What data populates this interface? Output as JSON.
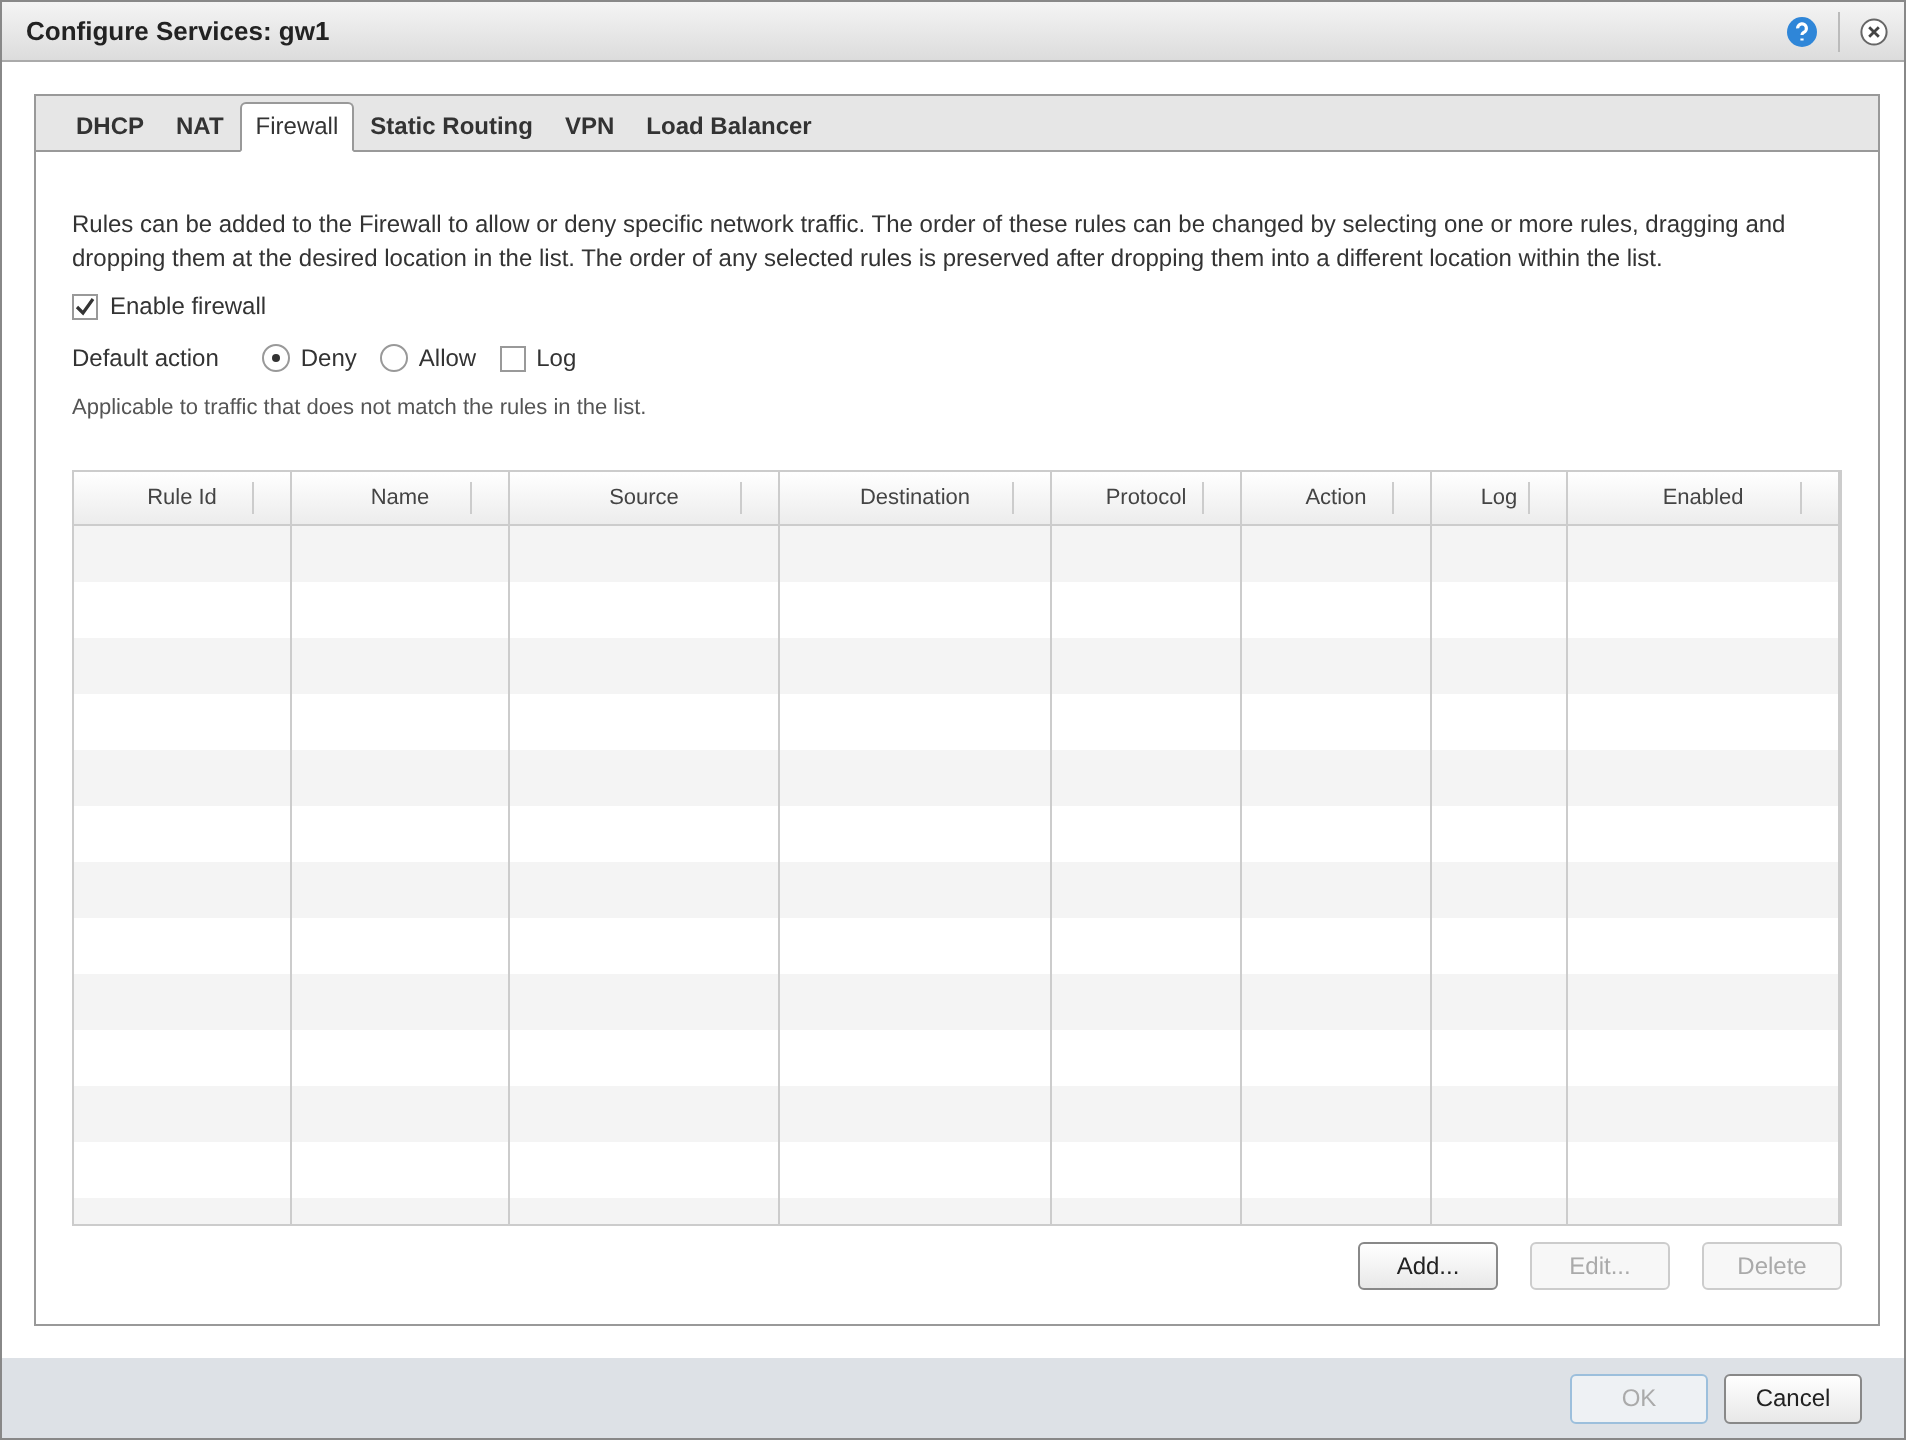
{
  "window": {
    "title": "Configure Services: gw1"
  },
  "tabs": [
    {
      "label": "DHCP",
      "selected": false
    },
    {
      "label": "NAT",
      "selected": false
    },
    {
      "label": "Firewall",
      "selected": true
    },
    {
      "label": "Static Routing",
      "selected": false
    },
    {
      "label": "VPN",
      "selected": false
    },
    {
      "label": "Load Balancer",
      "selected": false
    }
  ],
  "description": "Rules can be added to the Firewall to allow or deny specific network traffic. The order of these rules can be changed by selecting one or more rules, dragging and dropping them at the desired location in the list. The order of any selected rules is preserved after dropping them into a different location within the list.",
  "enable_firewall": {
    "label": "Enable firewall",
    "checked": true
  },
  "default_action": {
    "label": "Default action",
    "options": [
      {
        "label": "Deny",
        "selected": true
      },
      {
        "label": "Allow",
        "selected": false
      }
    ],
    "log": {
      "label": "Log",
      "checked": false
    }
  },
  "hint": "Applicable to traffic that does not match the rules in the list.",
  "table": {
    "columns": [
      "Rule Id",
      "Name",
      "Source",
      "Destination",
      "Protocol",
      "Action",
      "Log",
      "Enabled"
    ]
  },
  "table_buttons": [
    {
      "label": "Add...",
      "disabled": false
    },
    {
      "label": "Edit...",
      "disabled": true
    },
    {
      "label": "Delete",
      "disabled": true
    }
  ],
  "footer_buttons": [
    {
      "label": "OK",
      "disabled": true
    },
    {
      "label": "Cancel",
      "disabled": false
    }
  ]
}
